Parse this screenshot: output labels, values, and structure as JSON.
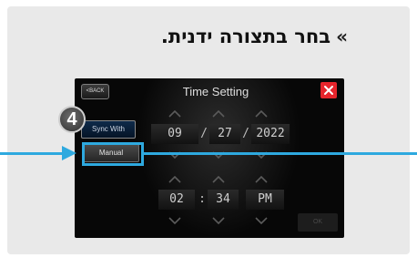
{
  "instruction": {
    "text": "בחר בתצורה ידנית.",
    "arrow": "»"
  },
  "screen": {
    "title": "Time Setting",
    "back_label": "<BACK",
    "sync_label": "Sync With Phone",
    "manual_label": "Manual",
    "date": {
      "month": "09",
      "day": "27",
      "year": "2022",
      "separator": "/"
    },
    "time": {
      "hour": "02",
      "minute": "34",
      "period": "PM",
      "separator": ":"
    },
    "ok_label": "OK"
  },
  "callout": {
    "step_number": "4",
    "accent_color": "#2ea9df",
    "close_color": "#e6252c"
  },
  "icons": [
    "close-icon",
    "chevron-up-icon",
    "chevron-down-icon",
    "callout-arrow"
  ]
}
